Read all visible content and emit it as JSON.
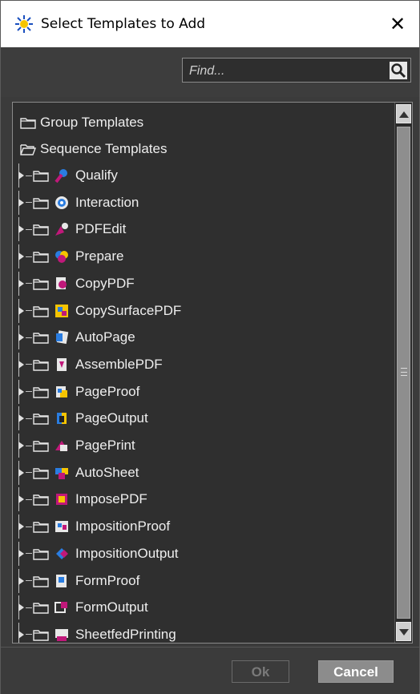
{
  "window": {
    "title": "Select Templates to Add",
    "close_symbol": "✕"
  },
  "find": {
    "placeholder": "Find...",
    "value": ""
  },
  "tree": {
    "top_items": [
      {
        "label": "Group Templates",
        "icon": "folder-closed-icon",
        "expanded": false
      },
      {
        "label": "Sequence Templates",
        "icon": "folder-open-icon",
        "expanded": true
      }
    ],
    "children": [
      {
        "label": "Qualify",
        "icon": "qualify-icon"
      },
      {
        "label": "Interaction",
        "icon": "interaction-icon"
      },
      {
        "label": "PDFEdit",
        "icon": "pdfedit-icon"
      },
      {
        "label": "Prepare",
        "icon": "prepare-icon"
      },
      {
        "label": "CopyPDF",
        "icon": "copypdf-icon"
      },
      {
        "label": "CopySurfacePDF",
        "icon": "copysurfacepdf-icon"
      },
      {
        "label": "AutoPage",
        "icon": "autopage-icon"
      },
      {
        "label": "AssemblePDF",
        "icon": "assemblepdf-icon"
      },
      {
        "label": "PageProof",
        "icon": "pageproof-icon"
      },
      {
        "label": "PageOutput",
        "icon": "pageoutput-icon"
      },
      {
        "label": "PagePrint",
        "icon": "pageprint-icon"
      },
      {
        "label": "AutoSheet",
        "icon": "autosheet-icon"
      },
      {
        "label": "ImposePDF",
        "icon": "imposepdf-icon"
      },
      {
        "label": "ImpositionProof",
        "icon": "impositionproof-icon"
      },
      {
        "label": "ImpositionOutput",
        "icon": "impositionoutput-icon"
      },
      {
        "label": "FormProof",
        "icon": "formproof-icon"
      },
      {
        "label": "FormOutput",
        "icon": "formoutput-icon"
      },
      {
        "label": "SheetfedPrinting",
        "icon": "sheetfedprinting-icon"
      }
    ]
  },
  "buttons": {
    "ok": "Ok",
    "cancel": "Cancel"
  },
  "colors": {
    "background": "#3b3b3b",
    "panel": "#2f2f2f",
    "text": "#eeeeee",
    "cancel_button": "#8c8c8c",
    "ok_disabled_text": "#7a7a7a"
  }
}
